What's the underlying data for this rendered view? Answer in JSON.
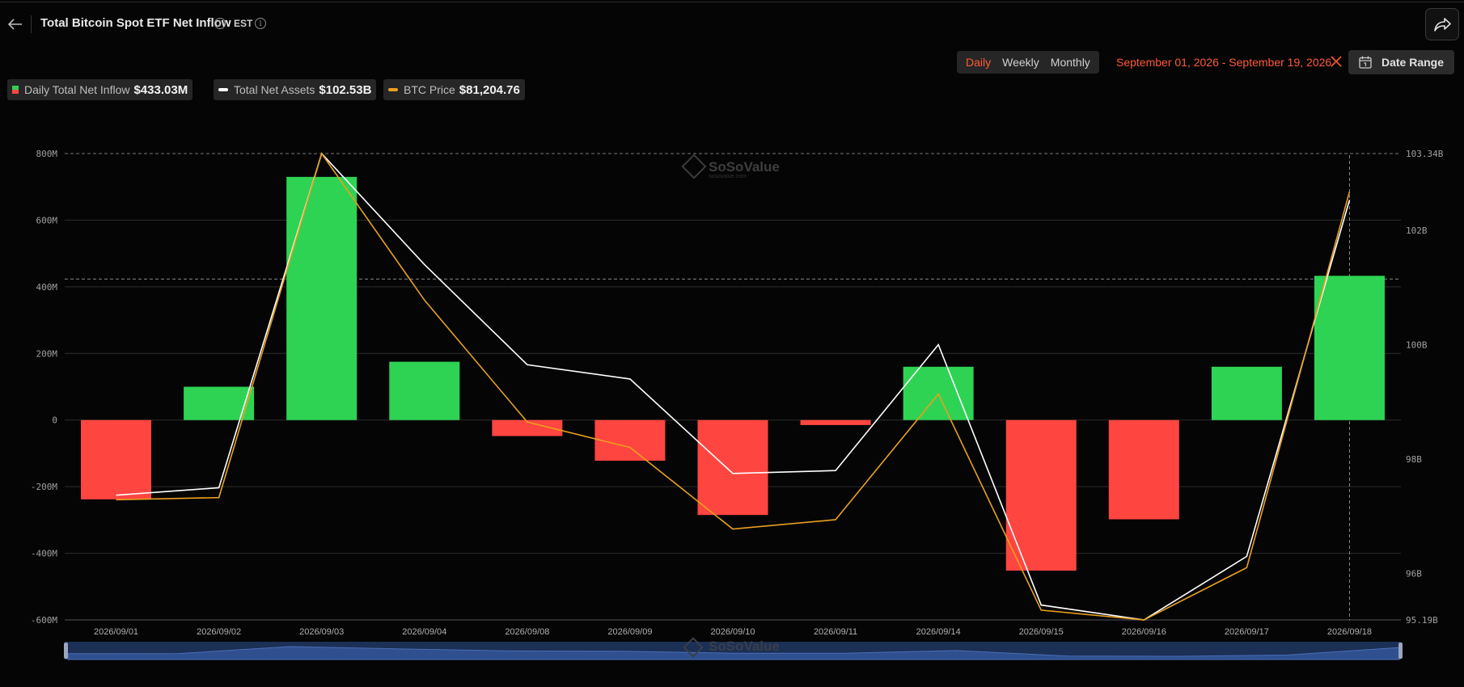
{
  "header": {
    "title": "Total Bitcoin Spot ETF Net Inflow",
    "timezone": "EST"
  },
  "controls": {
    "periods": [
      "Daily",
      "Weekly",
      "Monthly"
    ],
    "active_period": "Daily",
    "date_text": "September 01, 2026 - September 19, 2026",
    "date_range_label": "Date Range"
  },
  "legend": {
    "inflow": {
      "name": "Daily Total Net Inflow",
      "value": "$433.03M"
    },
    "assets": {
      "name": "Total Net Assets",
      "value": "$102.53B"
    },
    "btc": {
      "name": "BTC Price",
      "value": "$81,204.76"
    }
  },
  "watermark": {
    "name": "SoSoValue",
    "sub": "sosovalue.com"
  },
  "colors": {
    "positive": "#2ed354",
    "negative": "#ff4540",
    "assets_line": "#ffffff",
    "price_line": "#e8a020",
    "accent": "#ff5a36"
  },
  "chart_data": {
    "type": "bar",
    "categories": [
      "2026/09/01",
      "2026/09/02",
      "2026/09/03",
      "2026/09/04",
      "2026/09/08",
      "2026/09/09",
      "2026/09/10",
      "2026/09/11",
      "2026/09/14",
      "2026/09/15",
      "2026/09/16",
      "2026/09/17",
      "2026/09/18"
    ],
    "series": [
      {
        "name": "Daily Total Net Inflow",
        "type": "bar",
        "axis": "left",
        "values": [
          -238,
          100,
          730,
          175,
          -48,
          -122,
          -285,
          -15,
          160,
          -452,
          -298,
          160,
          433
        ]
      },
      {
        "name": "Total Net Assets",
        "type": "line",
        "axis": "right",
        "values": [
          97.37,
          97.5,
          103.34,
          101.4,
          99.65,
          99.4,
          97.75,
          97.8,
          100.0,
          95.45,
          95.19,
          96.3,
          102.53
        ]
      },
      {
        "name": "BTC Price",
        "type": "line",
        "axis": "right-normalized",
        "values": [
          73950,
          74000,
          82100,
          78650,
          75780,
          75180,
          73260,
          73480,
          76440,
          71350,
          71120,
          72350,
          81204.76
        ]
      }
    ],
    "y_left": {
      "ticks": [
        "800M",
        "600M",
        "400M",
        "200M",
        "0",
        "-200M",
        "-400M",
        "-600M"
      ],
      "min": -600,
      "max": 800
    },
    "y_right": {
      "ticks": [
        "103.34B",
        "102B",
        "100B",
        "98B",
        "96B",
        "95.19B"
      ],
      "tick_values": [
        103.34,
        102,
        100,
        98,
        96,
        95.19
      ],
      "min": 95.19,
      "max": 103.34
    },
    "btc_range": [
      71120,
      82100
    ],
    "grid": true,
    "legend_position": "top-left"
  }
}
